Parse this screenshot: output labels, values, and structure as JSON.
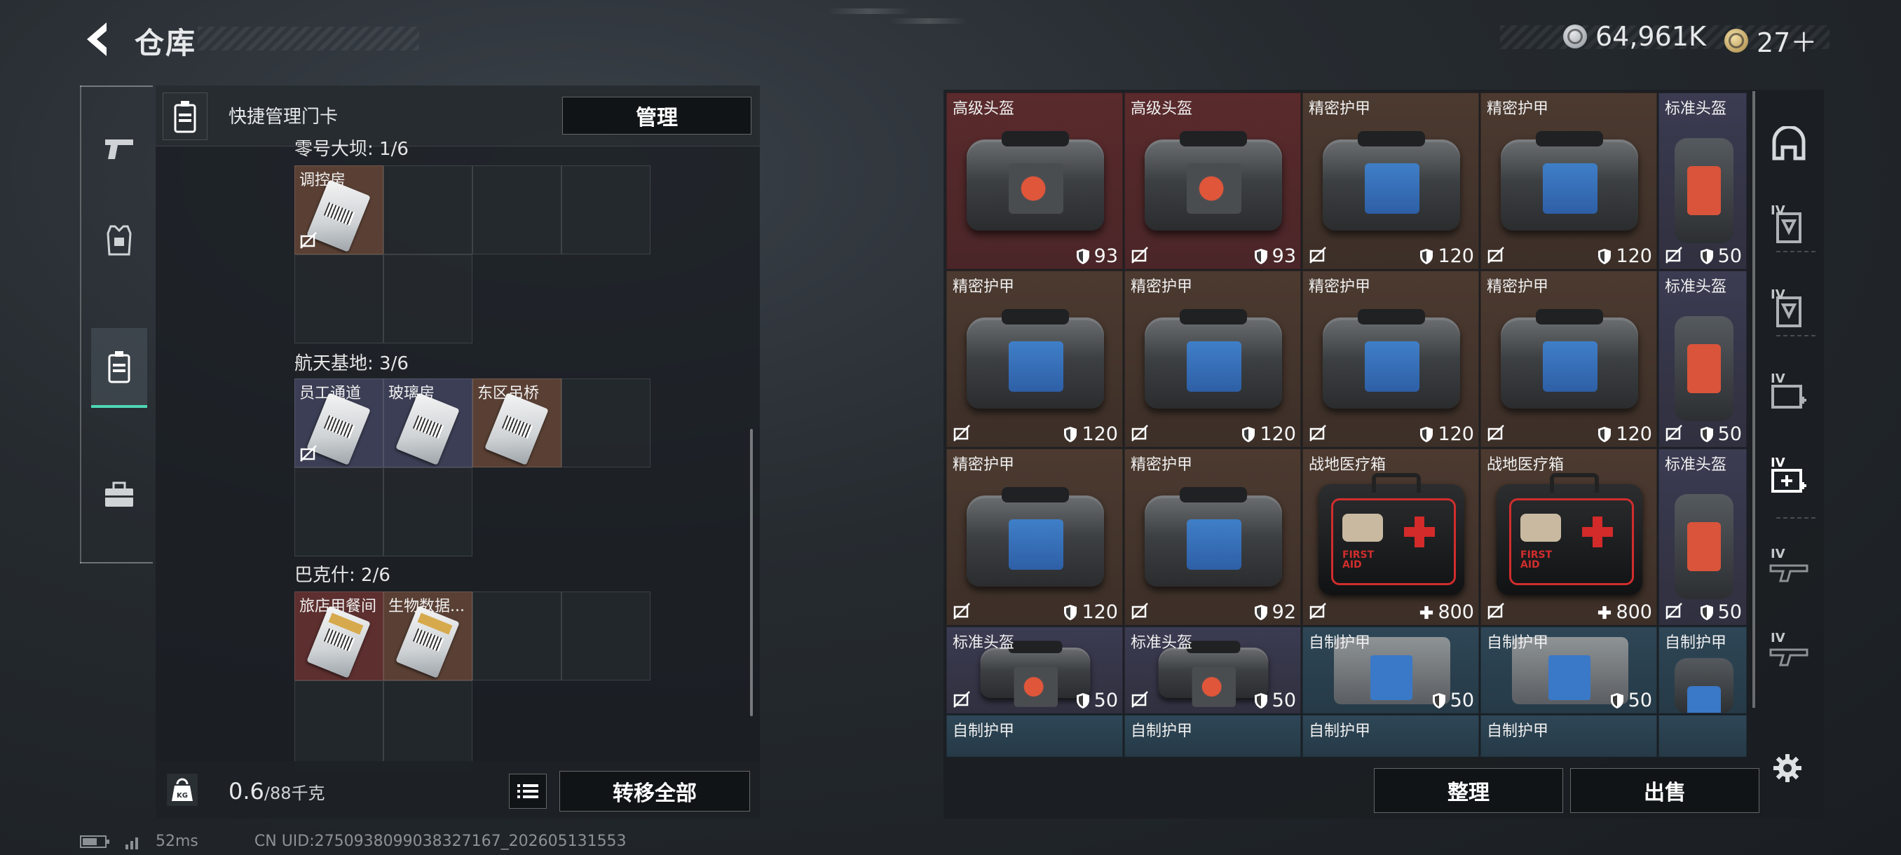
{
  "header": {
    "title": "仓库"
  },
  "currency": [
    {
      "icon": "silver-coin-icon",
      "value": "64,961K"
    },
    {
      "icon": "gold-coin-icon",
      "value": "27＋"
    }
  ],
  "left_rail": [
    {
      "name": "weapons",
      "icon": "pistol-icon"
    },
    {
      "name": "equipment",
      "icon": "vest-icon"
    },
    {
      "name": "keycards",
      "icon": "keycard-icon",
      "active": true
    },
    {
      "name": "supplies",
      "icon": "briefcase-icon"
    }
  ],
  "cards_panel": {
    "header_title": "快捷管理门卡",
    "manage_button": "管理",
    "sections": [
      {
        "label": "零号大坝: 1/6",
        "cards": [
          {
            "label": "调控房",
            "color": "brown",
            "locked": true
          }
        ]
      },
      {
        "label": "航天基地: 3/6",
        "cards": [
          {
            "label": "员工通道",
            "color": "blue",
            "locked": true
          },
          {
            "label": "玻璃房",
            "color": "blue",
            "locked": false
          },
          {
            "label": "东区吊桥",
            "color": "brown",
            "locked": false
          }
        ]
      },
      {
        "label": "巴克什: 2/6",
        "cards": [
          {
            "label": "旅店用餐间",
            "color": "red",
            "locked": false
          },
          {
            "label": "生物数据...",
            "color": "brown",
            "locked": false
          }
        ]
      }
    ],
    "weight_value": "0.6",
    "weight_max": "/88千克",
    "transfer_all_button": "转移全部"
  },
  "inventory": {
    "rows": [
      [
        {
          "label": "高级头盔",
          "bg": "red",
          "art": "bag-red",
          "stat": "93",
          "stat_icon": "shield",
          "nolock": false
        },
        {
          "label": "高级头盔",
          "bg": "red",
          "art": "bag-red",
          "stat": "93",
          "stat_icon": "shield",
          "nolock": true
        },
        {
          "label": "精密护甲",
          "bg": "brown",
          "art": "bag-blue",
          "stat": "120",
          "stat_icon": "shield",
          "nolock": true
        },
        {
          "label": "精密护甲",
          "bg": "brown",
          "art": "bag-blue",
          "stat": "120",
          "stat_icon": "shield",
          "nolock": true
        },
        {
          "label": "标准头盔",
          "bg": "purple",
          "art": "pack-red",
          "stat": "50",
          "stat_icon": "shield",
          "nolock": true
        }
      ],
      [
        {
          "label": "精密护甲",
          "bg": "brown",
          "art": "bag-blue",
          "stat": "120",
          "stat_icon": "shield",
          "nolock": true
        },
        {
          "label": "精密护甲",
          "bg": "brown",
          "art": "bag-blue",
          "stat": "120",
          "stat_icon": "shield",
          "nolock": true
        },
        {
          "label": "精密护甲",
          "bg": "brown",
          "art": "bag-blue",
          "stat": "120",
          "stat_icon": "shield",
          "nolock": true
        },
        {
          "label": "精密护甲",
          "bg": "brown",
          "art": "bag-blue",
          "stat": "120",
          "stat_icon": "shield",
          "nolock": true
        },
        {
          "label": "标准头盔",
          "bg": "purple",
          "art": "pack-red",
          "stat": "50",
          "stat_icon": "shield",
          "nolock": true
        }
      ],
      [
        {
          "label": "精密护甲",
          "bg": "brown",
          "art": "bag-blue",
          "stat": "120",
          "stat_icon": "shield",
          "nolock": true
        },
        {
          "label": "精密护甲",
          "bg": "brown",
          "art": "bag-blue",
          "stat": "92",
          "stat_icon": "shield",
          "nolock": true
        },
        {
          "label": "战地医疗箱",
          "bg": "brown",
          "art": "medkit",
          "stat": "800",
          "stat_icon": "plus",
          "nolock": true
        },
        {
          "label": "战地医疗箱",
          "bg": "brown",
          "art": "medkit",
          "stat": "800",
          "stat_icon": "plus",
          "nolock": true
        },
        {
          "label": "标准头盔",
          "bg": "purple",
          "art": "pack-red",
          "stat": "50",
          "stat_icon": "shield",
          "nolock": true
        }
      ],
      [
        {
          "label": "标准头盔",
          "bg": "purple",
          "art": "bag-red",
          "stat": "50",
          "stat_icon": "shield",
          "nolock": true
        },
        {
          "label": "标准头盔",
          "bg": "purple",
          "art": "bag-red",
          "stat": "50",
          "stat_icon": "shield",
          "nolock": true
        },
        {
          "label": "自制护甲",
          "bg": "teal",
          "art": "vest",
          "stat": "50",
          "stat_icon": "shield",
          "nolock": false
        },
        {
          "label": "自制护甲",
          "bg": "teal",
          "art": "vest",
          "stat": "50",
          "stat_icon": "shield",
          "nolock": false
        },
        {
          "label": "自制护甲",
          "bg": "teal",
          "art": "pack-blue",
          "stat": "",
          "stat_icon": "",
          "nolock": false
        }
      ],
      [
        {
          "label": "自制护甲",
          "bg": "teal",
          "art": "",
          "stat": "",
          "stat_icon": "",
          "nolock": false
        },
        {
          "label": "自制护甲",
          "bg": "teal",
          "art": "",
          "stat": "",
          "stat_icon": "",
          "nolock": false
        },
        {
          "label": "自制护甲",
          "bg": "teal",
          "art": "",
          "stat": "",
          "stat_icon": "",
          "nolock": false
        },
        {
          "label": "自制护甲",
          "bg": "teal",
          "art": "",
          "stat": "",
          "stat_icon": "",
          "nolock": false
        },
        {
          "label": "",
          "bg": "teal",
          "art": "",
          "stat": "",
          "stat_icon": "",
          "nolock": false
        }
      ]
    ],
    "sort_button": "整理",
    "sell_button": "出售"
  },
  "filter_rail": [
    {
      "icon": "helmet-filter-icon",
      "tag": ""
    },
    {
      "icon": "armor-filter-icon",
      "tag": "IV"
    },
    {
      "icon": "armor-filter-icon",
      "tag": "IV"
    },
    {
      "icon": "medkit-filter-icon",
      "tag": "IV"
    },
    {
      "icon": "medkit-filter-icon",
      "tag": "IV"
    },
    {
      "icon": "weapon-filter-icon",
      "tag": "IV"
    },
    {
      "icon": "weapon-filter-icon",
      "tag": "IV"
    }
  ],
  "status": {
    "ping": "52ms",
    "uid": "CN UID:2750938099038327167_202605131553"
  },
  "colors": {
    "accent": "#4fd7b5",
    "red_rarity": "#5a2a2c",
    "brown_rarity": "#4c3a30",
    "purple_rarity": "#3b3b52",
    "teal_rarity": "#2e4656"
  }
}
